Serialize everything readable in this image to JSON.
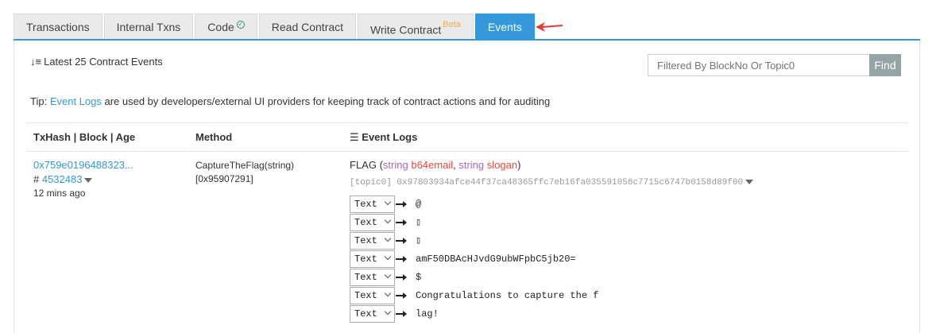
{
  "tabs": [
    {
      "label": "Transactions"
    },
    {
      "label": "Internal Txns"
    },
    {
      "label": "Code",
      "badge": "✓"
    },
    {
      "label": "Read Contract"
    },
    {
      "label": "Write Contract",
      "badge": "Beta"
    },
    {
      "label": "Events",
      "active": true
    }
  ],
  "header": {
    "sort_icon": "sort-desc-icon",
    "latest": "Latest 25 Contract Events",
    "filter_placeholder": "Filtered By BlockNo Or Topic0",
    "find_label": "Find"
  },
  "tip": {
    "prefix": "Tip: ",
    "link": "Event Logs",
    "suffix": " are used by developers/external UI providers for keeping track of contract actions and for auditing"
  },
  "columns": {
    "txhash": "TxHash | Block | Age",
    "method": "Method",
    "logs": "Event Logs",
    "logs_icon": "list-icon"
  },
  "row": {
    "txhash": "0x759e0196488323...",
    "block_prefix": "# ",
    "block": "4532483",
    "age": "12 mins ago",
    "method": "CaptureTheFlag(string)",
    "method_id": "[0x95907291]",
    "event_name": "FLAG",
    "event_open": " (",
    "param1_type": "string",
    "param1_name": "b64email",
    "sep": ", ",
    "param2_type": "string",
    "param2_name": "slogan",
    "event_close": ")",
    "topic0": "[topic0] 0x97803934afce44f37ca48365ffc7eb16fa035591056c7715c6747b0158d89f00",
    "data": [
      {
        "format": "Text",
        "value": "@"
      },
      {
        "format": "Text",
        "value": "▯"
      },
      {
        "format": "Text",
        "value": "▯"
      },
      {
        "format": "Text",
        "value": "amF50DBAcHJvdG9ubWFpbC5jb20="
      },
      {
        "format": "Text",
        "value": "$"
      },
      {
        "format": "Text",
        "value": "Congratulations to capture the f"
      },
      {
        "format": "Text",
        "value": "lag!"
      }
    ]
  },
  "colors": {
    "accent": "#3498db",
    "find_button": "#95a5a6",
    "beta": "#f0ad4e",
    "param_type": "#a569bd",
    "param_name": "#e74c3c",
    "arrow": "#e53935"
  }
}
